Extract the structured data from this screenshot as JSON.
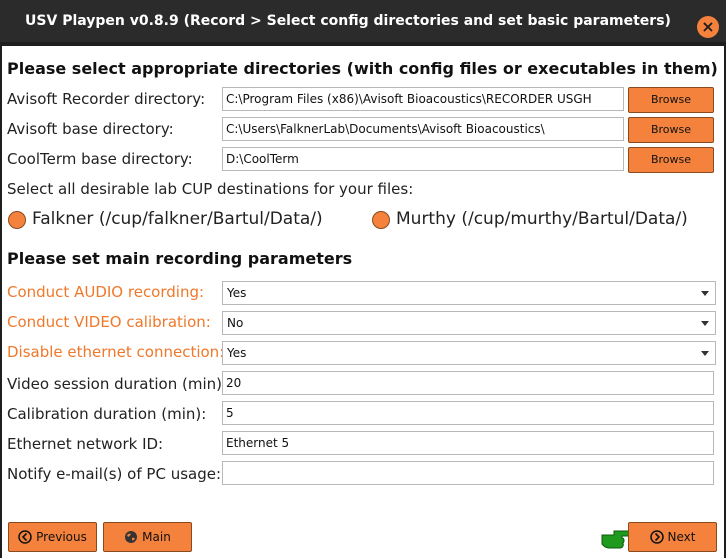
{
  "window": {
    "title": "USV Playpen v0.8.9 (Record > Select config directories and set basic parameters)",
    "close_glyph": "×"
  },
  "directories": {
    "heading": "Please select appropriate directories (with config files or executables in them)",
    "recorder": {
      "label": "Avisoft Recorder directory:",
      "value": "C:\\Program Files (x86)\\Avisoft Bioacoustics\\RECORDER USGH",
      "button": "Browse"
    },
    "avisoft_base": {
      "label": "Avisoft base directory:",
      "value": "C:\\Users\\FalknerLab\\Documents\\Avisoft Bioacoustics\\",
      "button": "Browse"
    },
    "coolterm": {
      "label": "CoolTerm base directory:",
      "value": "D:\\CoolTerm",
      "button": "Browse"
    }
  },
  "cup": {
    "label": "Select all desirable lab CUP destinations for your files:",
    "options": [
      {
        "label": "Falkner (/cup/falkner/Bartul/Data/)"
      },
      {
        "label": "Murthy (/cup/murthy/Bartul/Data/)"
      }
    ]
  },
  "params": {
    "heading": "Please set main recording parameters",
    "audio": {
      "label": "Conduct AUDIO recording:",
      "value": "Yes"
    },
    "video": {
      "label": "Conduct VIDEO calibration:",
      "value": "No"
    },
    "ethernet_disable": {
      "label": "Disable ethernet connection:",
      "value": "Yes"
    },
    "video_duration": {
      "label": "Video session duration (min):",
      "value": "20"
    },
    "calib_duration": {
      "label": "Calibration duration (min):",
      "value": "5"
    },
    "network_id": {
      "label": "Ethernet network ID:",
      "value": "Ethernet 5"
    },
    "notify_email": {
      "label": "Notify e-mail(s) of PC usage:",
      "value": ""
    }
  },
  "nav": {
    "previous": "Previous",
    "main": "Main",
    "next": "Next"
  },
  "colors": {
    "accent": "#f4823c",
    "highlight_label": "#f0782a",
    "pointer_hand": "#1f9a1f"
  },
  "icons": [
    "close-icon",
    "previous-arrow-icon",
    "globe-icon",
    "next-arrow-icon",
    "pointing-hand-icon",
    "dropdown-arrow-icon"
  ]
}
